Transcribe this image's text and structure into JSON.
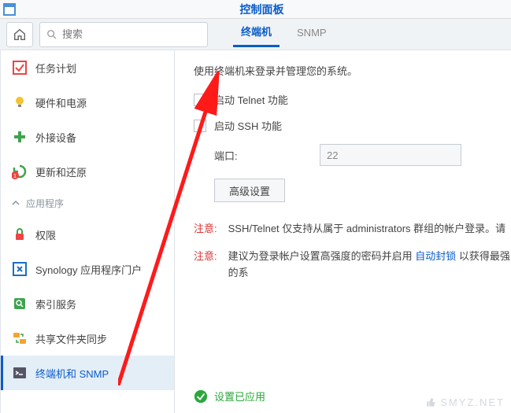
{
  "window": {
    "title": "控制面板"
  },
  "search": {
    "placeholder": "搜索"
  },
  "tabs": [
    {
      "label": "终端机",
      "active": true
    },
    {
      "label": "SNMP",
      "active": false
    }
  ],
  "sidebar": {
    "items": [
      {
        "name": "task-scheduler",
        "label": "任务计划"
      },
      {
        "name": "hardware-power",
        "label": "硬件和电源"
      },
      {
        "name": "external-devices",
        "label": "外接设备"
      },
      {
        "name": "update-restore",
        "label": "更新和还原"
      }
    ],
    "group": {
      "label": "应用程序"
    },
    "items2": [
      {
        "name": "privileges",
        "label": "权限"
      },
      {
        "name": "app-portal",
        "label": "Synology 应用程序门户"
      },
      {
        "name": "indexing",
        "label": "索引服务"
      },
      {
        "name": "shared-sync",
        "label": "共享文件夹同步"
      },
      {
        "name": "terminal-snmp",
        "label": "终端机和 SNMP"
      }
    ]
  },
  "main": {
    "intro": "使用终端机来登录并管理您的系统。",
    "telnet_label": "启动 Telnet 功能",
    "ssh_label": "启动 SSH 功能",
    "port_label": "端口:",
    "port_value": "22",
    "advanced_btn": "高级设置",
    "note_label": "注意:",
    "note1": "SSH/Telnet 仅支持从属于 administrators 群组的帐户登录。请",
    "note2_prefix": "建议为登录帐户设置高强度的密码并启用 ",
    "note2_link": "自动封锁",
    "note2_suffix": " 以获得最强的系",
    "applied": "设置已应用"
  },
  "watermark": "SMYZ.NET"
}
